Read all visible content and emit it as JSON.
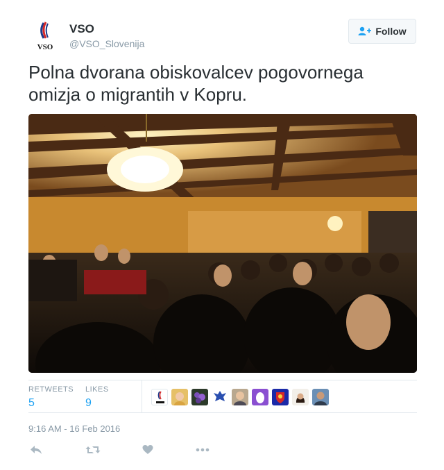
{
  "author": {
    "name": "VSO",
    "handle": "@VSO_Slovenija",
    "logo_text": "VSO"
  },
  "follow": {
    "label": "Follow"
  },
  "tweet": {
    "text": "Polna dvorana obiskovalcev pogovornega omizja o migrantih v Kopru."
  },
  "stats": {
    "retweets_label": "RETWEETS",
    "retweets": "5",
    "likes_label": "LIKES",
    "likes": "9"
  },
  "likers": [
    {
      "icon": "vso-logo-avatar"
    },
    {
      "icon": "blonde-woman-avatar"
    },
    {
      "icon": "purple-flowers-avatar"
    },
    {
      "icon": "eagle-emblem-avatar"
    },
    {
      "icon": "woman-portrait-avatar"
    },
    {
      "icon": "purple-egg-avatar"
    },
    {
      "icon": "coat-of-arms-avatar"
    },
    {
      "icon": "dark-hair-woman-avatar"
    },
    {
      "icon": "man-portrait-avatar"
    }
  ],
  "timestamp": "9:16 AM - 16 Feb 2016",
  "actions": [
    {
      "icon": "reply-icon"
    },
    {
      "icon": "retweet-icon"
    },
    {
      "icon": "heart-icon"
    },
    {
      "icon": "more-icon"
    }
  ],
  "colors": {
    "accent": "#1da1f2",
    "text": "#292f33",
    "muted": "#8899a6",
    "border": "#e1e8ed"
  }
}
